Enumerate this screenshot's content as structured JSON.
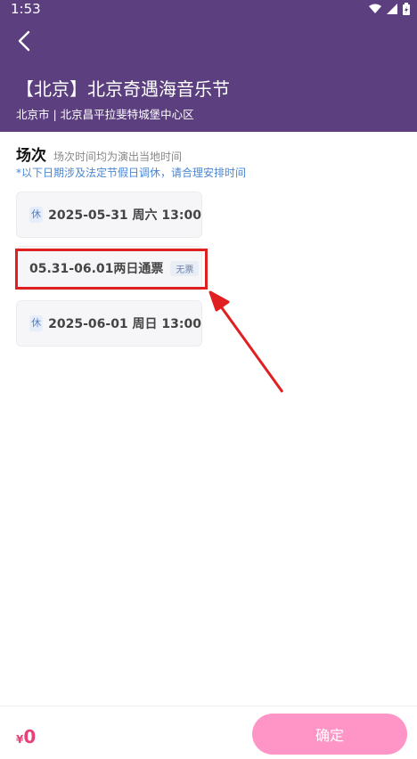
{
  "status": {
    "time": "1:53"
  },
  "header": {
    "title": "【北京】北京奇遇海音乐节",
    "subtitle": "北京市 | 北京昌平拉斐特城堡中心区"
  },
  "session": {
    "title": "场次",
    "note": "场次时间均为演出当地时间",
    "holiday_note": "*以下日期涉及法定节假日调休，请合理安排时间"
  },
  "options": [
    {
      "badge": "休",
      "label": "2025-05-31 周六 13:00"
    },
    {
      "label": "05.31-06.01两日通票",
      "status": "无票"
    },
    {
      "badge": "休",
      "label": "2025-06-01 周日 13:00"
    }
  ],
  "footer": {
    "currency": "¥",
    "price": "0",
    "confirm_label": "确定"
  },
  "colors": {
    "header_bg": "#5b3f7e",
    "accent": "#e8407a",
    "confirm_bg": "#ff95c6",
    "highlight": "#e02020"
  }
}
